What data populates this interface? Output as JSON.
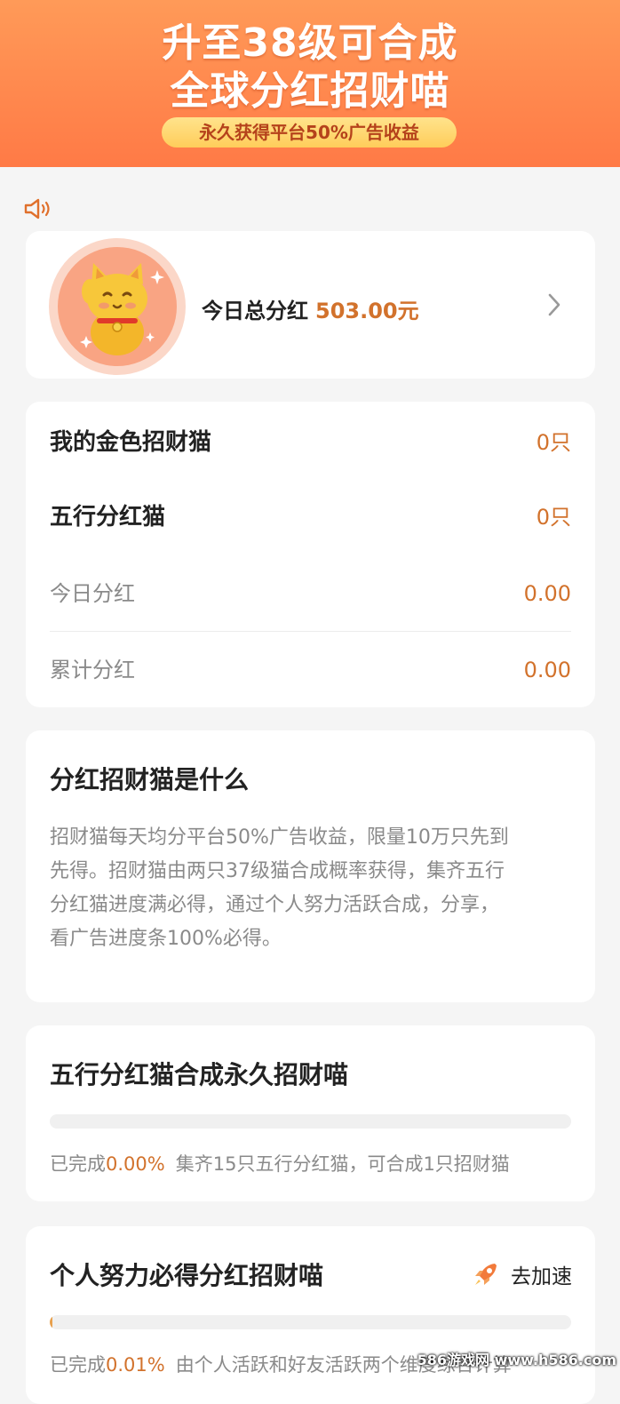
{
  "banner": {
    "title_line1": "升至38级可合成",
    "title_line2": "全球分红招财喵",
    "subtitle": "永久获得平台50%广告收益"
  },
  "summary": {
    "label": "今日总分红",
    "value": "503.00元"
  },
  "stats": {
    "golden_cat_label": "我的金色招财猫",
    "golden_cat_value": "0只",
    "five_elements_label": "五行分红猫",
    "five_elements_value": "0只",
    "today_dividend_label": "今日分红",
    "today_dividend_value": "0.00",
    "total_dividend_label": "累计分红",
    "total_dividend_value": "0.00"
  },
  "about": {
    "title": "分红招财猫是什么",
    "lines": [
      "招财猫每天均分平台50%广告收益，限量10万只先到",
      "先得。招财猫由两只37级猫合成概率获得，集齐五行",
      "分红猫进度满必得，通过个人努力活跃合成，分享，",
      "看广告进度条100%必得。"
    ]
  },
  "combine": {
    "title": "五行分红猫合成永久招财喵",
    "progress_percent": 0.0,
    "done_label": "已完成",
    "done_value": "0.00%",
    "note": "集齐15只五行分红猫，可合成1只招财猫"
  },
  "personal": {
    "title": "个人努力必得分红招财喵",
    "speed_label": "去加速",
    "progress_percent": 0.01,
    "done_label": "已完成",
    "done_value": "0.01%",
    "note": "由个人活跃和好友活跃两个维度综合计算"
  },
  "watermark": "586游戏网 www.h586.com",
  "colors": {
    "banner": "#ff7a46",
    "accent": "#d2722c",
    "pill": "#ffcd5a"
  }
}
